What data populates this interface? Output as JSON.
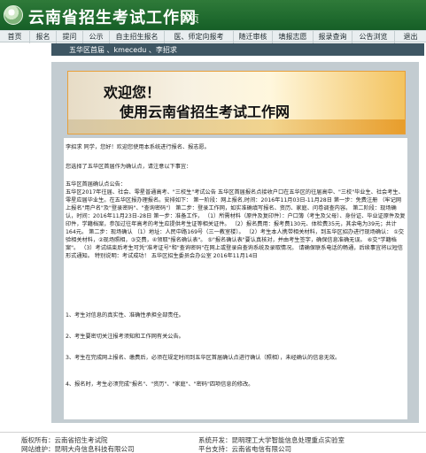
{
  "header": {
    "site_title": "云南省招生考试工作网",
    "home_tag": "首页"
  },
  "nav": {
    "items": [
      "首页",
      "报名",
      "提问",
      "公示",
      "自主招生报名",
      "医、师定向报考",
      "随迁审核",
      "填报志愿",
      "报录查询",
      "公告浏览",
      "退出"
    ]
  },
  "breadcrumb": "五华区首届 、kmecedu 、李招求",
  "welcome": {
    "title": "欢迎您！",
    "subtitle": "使用云南省招生考试工作网"
  },
  "content": {
    "greeting": "李招求 同学，您好！欢迎您使用本系统进行报名、报志愿。",
    "selected": "您选择了五华区首届作为确认点，请注意以下事宜：",
    "notice_title": "五华区首届确认点公告：",
    "notice_body": "五华区2017年往届、社会、零星普通高考、\"三校生\"考试公告 五华区首届报名点接收户口在五华区的往届高中、\"三校\"毕业生、社会考生、零星应届毕业生。在五华区报办理报名。安排如下： 第一阶段：网上报名,时间：2016年11月03日-11月28日 第一步：免费注册 （牢记网上报名\"用户名\"及\"登录密码\"、\"查询密码\"） 第二步：登录工作网，如实准确填写报名、资历、家庭、问卷调查内容。 第二阶段：现场确认，时间：2016年11月23日-28日 第一步：准备工作， （1）所需材料（原件及复印件）：户口簿（考生及父母）、身份证、毕业证原件及复印件，学籍档案，参加过往年高考的考生应提供考生证等相关证件。 （2）报名费用：报考费130元、体检费35元，其余电为39元；共计164元。 第二步：现场确认 （1）地址：人民中路169号（三一教室楼）。 （2）考生本人携带相关材料，到五华区招办进行现场确认： ①交验相关材料，②现场照相，③交费，④领取\"报名确认表\"。 ⑤\"报名确认表\"要认真核对，并由考生签字，确保信息准确无误。 ⑥交\"学籍档案\"。 （3）考试结束后考生可凭\"准考证号\"和\"查询密码\"在网上或登录自查询系统及录取情况。 请确保联系电话的畅通，后续事宜将以短信形式通知。 特别说明：考试成功！ 五华区招生委员会办公室 2016年11月14日",
    "items": [
      "1、考生对信息的真实性、准确性承担全部责任。",
      "2、考生要密切关注报考须知和工作网有关公告。",
      "3、考生在完成网上报名、缴费后，必须在规定时间到五华区首届确认点进行确认（照相），未经确认的信息无效。",
      "4、报名时，考生必须完成\"报名\"、\"资历\"、\"家庭\"、\"密码\"四项信息的修改。"
    ]
  },
  "footer": {
    "copyright_label": "版权所有：",
    "copyright_value": "云南省招生考试院",
    "maintain_label": "网站维护：",
    "maintain_value": "昆明大舟信息科技有限公司",
    "support_label": "系统开发：",
    "support_value": "昆明理工大学智能信息处理重点实验室",
    "platform_label": "平台支持：",
    "platform_value": "云南省电信有限公司"
  }
}
